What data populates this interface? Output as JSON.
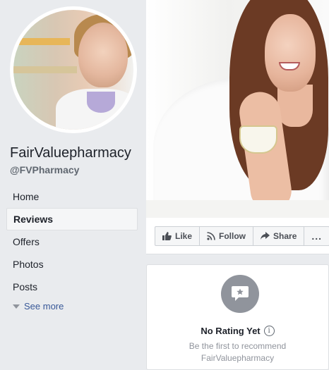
{
  "page": {
    "name": "FairValuepharmacy",
    "handle": "@FVPharmacy"
  },
  "nav": {
    "items": [
      {
        "label": "Home",
        "active": false
      },
      {
        "label": "Reviews",
        "active": true
      },
      {
        "label": "Offers",
        "active": false
      },
      {
        "label": "Photos",
        "active": false
      },
      {
        "label": "Posts",
        "active": false
      }
    ],
    "see_more": "See more"
  },
  "actions": {
    "like": "Like",
    "follow": "Follow",
    "share": "Share",
    "more": "..."
  },
  "reviews": {
    "title": "No Rating Yet",
    "info_glyph": "i",
    "line1": "Be the first to recommend",
    "line2": "FairValuepharmacy"
  },
  "icons": {
    "like": "thumbs-up-icon",
    "follow": "rss-icon",
    "share": "share-arrow-icon",
    "review": "star-speech-bubble-icon",
    "see_more": "triangle-down-icon",
    "info": "info-icon"
  },
  "colors": {
    "background": "#e9ebee",
    "link": "#385898",
    "muted": "#90949c",
    "text": "#1d2129"
  }
}
